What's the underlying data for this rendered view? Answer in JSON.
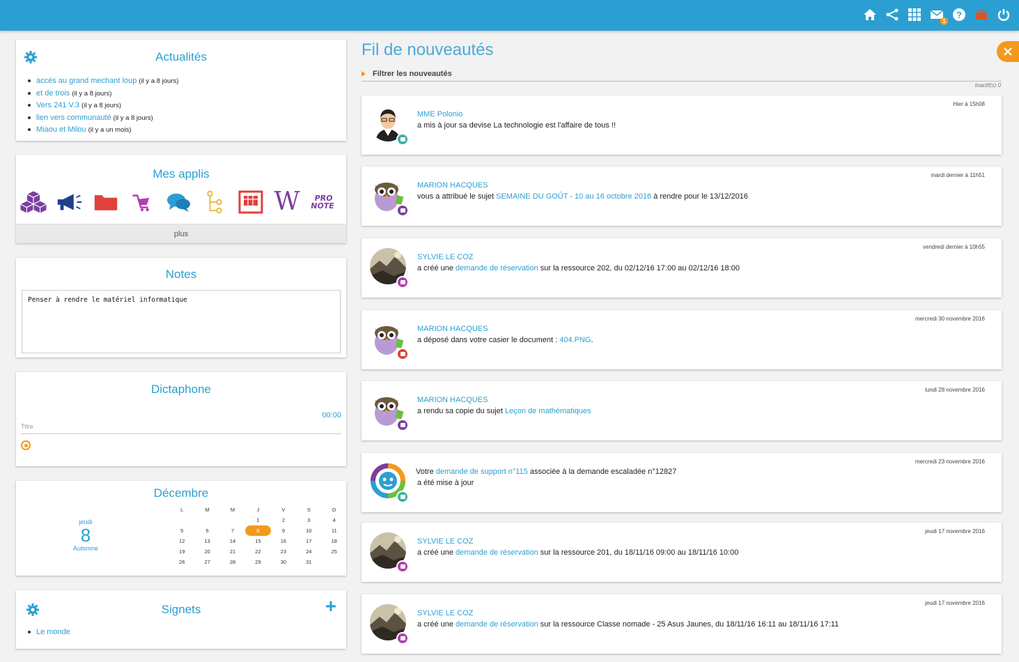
{
  "topbar": {
    "icons": [
      "home-icon",
      "share-icon",
      "apps-grid-icon",
      "mail-icon",
      "help-icon",
      "toolbox-icon",
      "power-icon"
    ],
    "mail_badge": "1"
  },
  "actualites": {
    "title": "Actualités",
    "items": [
      {
        "link": "accés au grand mechant loup",
        "meta": "(il y a 8 jours)"
      },
      {
        "link": "et de trois",
        "meta": "(il y a 8 jours)"
      },
      {
        "link": "Vers 241 V.3",
        "meta": "(il y a 8 jours)"
      },
      {
        "link": "lien vers communauté",
        "meta": "(il y a 8 jours)"
      },
      {
        "link": "Miaou et Milou",
        "meta": "(il y a un mois)"
      }
    ]
  },
  "applis": {
    "title": "Mes applis",
    "icons": [
      "cubes-icon",
      "megaphone-icon",
      "folder-icon",
      "cart-icon",
      "chat-icon",
      "tree-icon",
      "calendar-board-icon",
      "wiki-icon",
      "pronote-icon"
    ],
    "wiki_letter": "W",
    "pronote_label": [
      "PRO",
      "NOTE"
    ],
    "more": "plus"
  },
  "notes": {
    "title": "Notes",
    "value": "Penser à rendre le matériel informatique"
  },
  "dictaphone": {
    "title": "Dictaphone",
    "time": "00:00",
    "title_placeholder": "Titre"
  },
  "calendar": {
    "month": "Décembre",
    "day_name": "jeudi",
    "day_num": "8",
    "season": "Automne",
    "headers": [
      "L",
      "M",
      "M",
      "J",
      "V",
      "S",
      "D"
    ],
    "weeks": [
      [
        "",
        "",
        "",
        "1",
        "2",
        "3",
        "4"
      ],
      [
        "5",
        "6",
        "7",
        "8",
        "9",
        "10",
        "11"
      ],
      [
        "12",
        "13",
        "14",
        "15",
        "16",
        "17",
        "18"
      ],
      [
        "19",
        "20",
        "21",
        "22",
        "23",
        "24",
        "25"
      ],
      [
        "26",
        "27",
        "28",
        "29",
        "30",
        "31",
        ""
      ]
    ],
    "today": "8"
  },
  "signets": {
    "title": "Signets",
    "items": [
      "Le monde"
    ]
  },
  "feed": {
    "title": "Fil de nouveautés",
    "filter": "Filtrer les nouveautés",
    "inactif": "Inactif(s) 0",
    "items": [
      {
        "date": "Hier à 15h08",
        "name": "MME Polonio",
        "parts": [
          {
            "t": "a mis à jour sa devise La technologie est l'affaire de tous !!"
          }
        ],
        "avatar": "person",
        "badge": "#3bb3a0"
      },
      {
        "date": "mardi dernier à 11h51",
        "name": "MARION HACQUES",
        "parts": [
          {
            "t": "vous a attribué le sujet "
          },
          {
            "t": "SEMAINE DU GOÛT - 10 au 16 octobre 2016",
            "l": 1
          },
          {
            "t": " à rendre pour le 13/12/2016"
          }
        ],
        "avatar": "owl",
        "badge": "#7b3fa0"
      },
      {
        "date": "vendredi dernier à 10h55",
        "name": "SYLVIE LE COZ",
        "parts": [
          {
            "t": "a créé une "
          },
          {
            "t": "demande de réservation",
            "l": 1
          },
          {
            "t": " sur la ressource 202,  du 02/12/16 17:00 au 02/12/16 18:00"
          }
        ],
        "avatar": "photo",
        "badge": "#b23fb0"
      },
      {
        "date": "mercredi 30 novembre 2016",
        "name": "MARION HACQUES",
        "parts": [
          {
            "t": "a déposé dans votre casier le document : "
          },
          {
            "t": "404.PNG",
            "l": 1
          },
          {
            "t": "."
          }
        ],
        "avatar": "owl",
        "badge": "#e0413b"
      },
      {
        "date": "lundi 28 novembre 2016",
        "name": "MARION HACQUES",
        "parts": [
          {
            "t": "a rendu sa copie du sujet "
          },
          {
            "t": "Leçon de mathématiques",
            "l": 1
          }
        ],
        "avatar": "owl",
        "badge": "#7b3fa0"
      },
      {
        "date": "mercredi 23 novembre 2016",
        "name": "",
        "parts": [
          {
            "t": "Votre "
          },
          {
            "t": "demande de support n°115",
            "l": 1
          },
          {
            "t": " associée à la demande escaladée  n°12827"
          }
        ],
        "line2": "a été mise à jour",
        "avatar": "support",
        "badge": "#3bb3a0"
      },
      {
        "date": "jeudi 17 novembre 2016",
        "name": "SYLVIE LE COZ",
        "parts": [
          {
            "t": "a créé une "
          },
          {
            "t": "demande de réservation",
            "l": 1
          },
          {
            "t": " sur la ressource 201,  du 18/11/16 09:00 au 18/11/16 10:00"
          }
        ],
        "avatar": "photo",
        "badge": "#b23fb0"
      },
      {
        "date": "jeudi 17 novembre 2016",
        "name": "SYLVIE LE COZ",
        "parts": [
          {
            "t": "a créé une "
          },
          {
            "t": "demande de réservation",
            "l": 1
          },
          {
            "t": " sur la ressource Classe nomade - 25 Asus Jaunes,  du 18/11/16 16:11 au 18/11/16 17:11"
          }
        ],
        "avatar": "photo",
        "badge": "#b23fb0"
      }
    ]
  }
}
